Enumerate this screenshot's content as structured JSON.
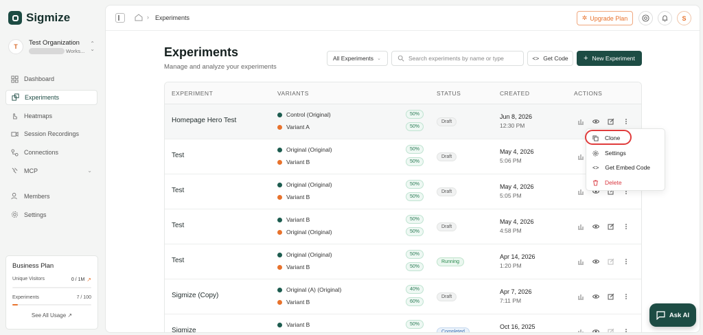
{
  "app": {
    "name": "Sigmize"
  },
  "org": {
    "name": "Test Organization",
    "sub": "Works...",
    "avatar": "T"
  },
  "sidebar": {
    "items": [
      {
        "label": "Dashboard"
      },
      {
        "label": "Experiments"
      },
      {
        "label": "Heatmaps"
      },
      {
        "label": "Session Recordings"
      },
      {
        "label": "Connections"
      },
      {
        "label": "MCP"
      },
      {
        "label": "Members"
      },
      {
        "label": "Settings"
      }
    ]
  },
  "plan": {
    "title": "Business Plan",
    "visitors_label": "Unique Visitors",
    "visitors_value": "0 / 1M",
    "experiments_label": "Experiments",
    "experiments_value": "7 / 100",
    "experiments_fill": 0.07,
    "link": "See All Usage"
  },
  "topbar": {
    "breadcrumb": "Experiments",
    "upgrade": "Upgrade Plan",
    "user": "S"
  },
  "page": {
    "title": "Experiments",
    "subtitle": "Manage and analyze your experiments",
    "filter": "All Experiments",
    "search_placeholder": "Search experiments by name or type",
    "get_code": "Get Code",
    "new_experiment": "New Experiment"
  },
  "table": {
    "headers": {
      "experiment": "EXPERIMENT",
      "variants": "VARIANTS",
      "status": "STATUS",
      "created": "CREATED",
      "actions": "ACTIONS"
    },
    "rows": [
      {
        "name": "Homepage Hero Test",
        "v1": "Control (Original)",
        "p1": "50%",
        "v2": "Variant A",
        "p2": "50%",
        "status": "Draft",
        "date": "Jun 8, 2026",
        "time": "12:30 PM"
      },
      {
        "name": "Test",
        "v1": "Original (Original)",
        "p1": "50%",
        "v2": "Variant B",
        "p2": "50%",
        "status": "Draft",
        "date": "May 4, 2026",
        "time": "5:06 PM"
      },
      {
        "name": "Test",
        "v1": "Original (Original)",
        "p1": "50%",
        "v2": "Variant B",
        "p2": "50%",
        "status": "Draft",
        "date": "May 4, 2026",
        "time": "5:05 PM"
      },
      {
        "name": "Test",
        "v1": "Variant B",
        "p1": "50%",
        "v2": "Original (Original)",
        "p2": "50%",
        "status": "Draft",
        "date": "May 4, 2026",
        "time": "4:58 PM"
      },
      {
        "name": "Test",
        "v1": "Original (Original)",
        "p1": "50%",
        "v2": "Variant B",
        "p2": "50%",
        "status": "Running",
        "date": "Apr 14, 2026",
        "time": "1:20 PM"
      },
      {
        "name": "Sigmize (Copy)",
        "v1": "Original (A) (Original)",
        "p1": "40%",
        "v2": "Variant B",
        "p2": "60%",
        "status": "Draft",
        "date": "Apr 7, 2026",
        "time": "7:11 PM"
      },
      {
        "name": "Sigmize",
        "v1": "Variant B",
        "p1": "50%",
        "v2": "",
        "p2": "",
        "status": "Completed",
        "date": "Oct 16, 2025",
        "time": ""
      }
    ]
  },
  "menu": {
    "clone": "Clone",
    "settings": "Settings",
    "embed": "Get Embed Code",
    "delete": "Delete"
  },
  "ask_ai": "Ask AI",
  "colors": {
    "brand": "#1d4c44",
    "accent": "#e8722c",
    "dot_green": "#1d5c4f",
    "dot_orange": "#e8722c",
    "delete": "#d9363e"
  }
}
